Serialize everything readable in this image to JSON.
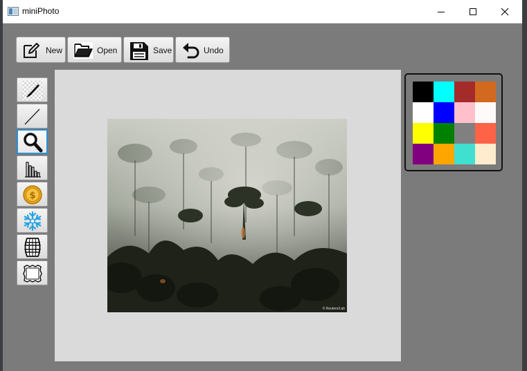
{
  "window": {
    "title": "miniPhoto"
  },
  "toolbar": {
    "new_label": "New",
    "open_label": "Open",
    "save_label": "Save",
    "undo_label": "Undo"
  },
  "tools": [
    {
      "name": "brush-tool",
      "icon": "brush-icon",
      "selected": false
    },
    {
      "name": "line-tool",
      "icon": "line-icon",
      "selected": false
    },
    {
      "name": "zoom-tool",
      "icon": "magnifier-icon",
      "selected": true
    },
    {
      "name": "histogram-tool",
      "icon": "histogram-icon",
      "selected": false
    },
    {
      "name": "coin-filter-tool",
      "icon": "coin-icon",
      "selected": false
    },
    {
      "name": "snowflake-filter-tool",
      "icon": "snowflake-icon",
      "selected": false
    },
    {
      "name": "barrel-filter-tool",
      "icon": "barrel-icon",
      "selected": false
    },
    {
      "name": "frame-filter-tool",
      "icon": "frame-icon",
      "selected": false
    }
  ],
  "canvas": {
    "image": "smoky-forest-photo",
    "credit": "© Reuters/Lab"
  },
  "palette": {
    "colors": [
      "#000000",
      "#00FFFF",
      "#A52A2A",
      "#D2691E",
      "#FFFFFF",
      "#0000FF",
      "#FFC0CB",
      "#FFFAFA",
      "#FFFF00",
      "#008000",
      "#808080",
      "#FF6347",
      "#800080",
      "#FFA500",
      "#40E0D0",
      "#FFEBCD"
    ]
  }
}
